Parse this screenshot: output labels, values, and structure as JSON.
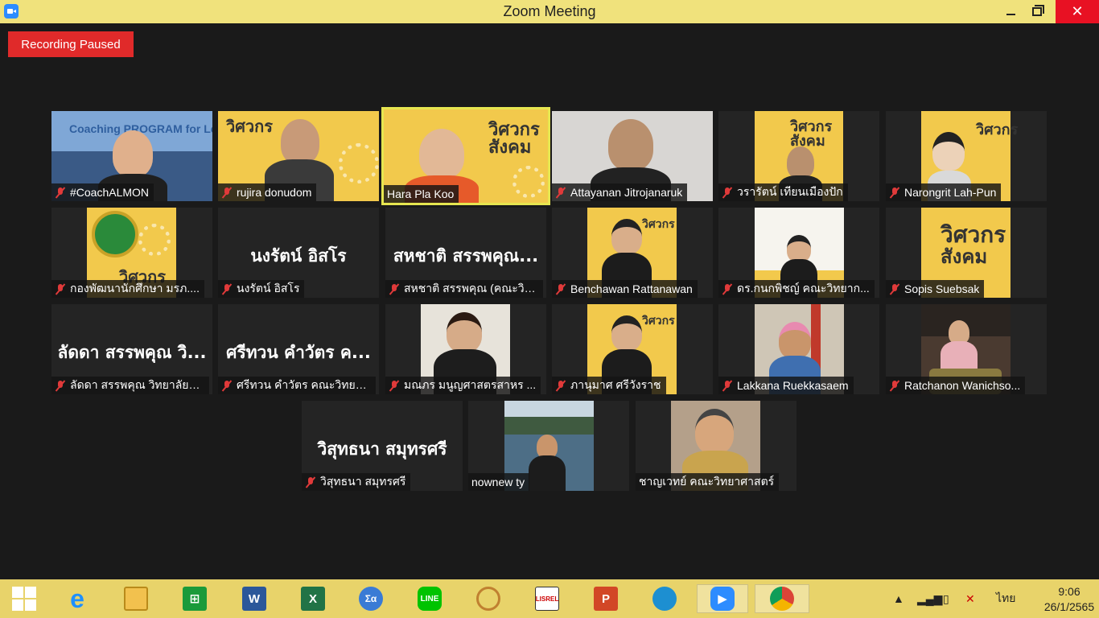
{
  "window": {
    "title": "Zoom Meeting"
  },
  "recording": {
    "label": "Recording Paused"
  },
  "participants": [
    {
      "name": "#CoachALMON",
      "overlay": "Coaching PROGRAM for Leader",
      "muted": true
    },
    {
      "name": "rujira donudom",
      "muted": true
    },
    {
      "name": "Hara Pla Koo",
      "muted": false
    },
    {
      "name": "Attayanan Jitrojanaruk",
      "muted": true
    },
    {
      "name": "วรารัตน์ เทียนเมืองปัก",
      "muted": true
    },
    {
      "name": "Narongrit Lah-Pun",
      "muted": true
    },
    {
      "name": "กองพัฒนานักศึกษา มรภ....",
      "muted": true
    },
    {
      "name": "นงรัตน์ อิสโร",
      "big": "นงรัตน์ อิสโร",
      "muted": true
    },
    {
      "name": "สหชาติ สรรพคุณ (คณะวิท...",
      "big": "สหชาติ สรรพคุณ...",
      "muted": true
    },
    {
      "name": "Benchawan Rattanawan",
      "muted": true
    },
    {
      "name": "ดร.กนกพิชญ์ คณะวิทยาก...",
      "muted": true
    },
    {
      "name": "Sopis Suebsak",
      "muted": true
    },
    {
      "name": "ลัดดา สรรพคุณ วิทยาลัยก...",
      "big": "ลัดดา สรรพคุณ วิ...",
      "muted": true
    },
    {
      "name": "ศรีทวน  คำวัตร คณะวิทยา...",
      "big": "ศรีทวน  คำวัตร ค...",
      "muted": true
    },
    {
      "name": "มณภร มนูญศาสตรสาหร ...",
      "muted": true
    },
    {
      "name": "ภานุมาศ ศรีวังราช",
      "muted": true
    },
    {
      "name": "Lakkana Ruekkasaem",
      "muted": true
    },
    {
      "name": "Ratchanon Wanichso...",
      "muted": true
    },
    {
      "name": "วิสุทธนา สมุทรศรี",
      "big": "วิสุทธนา สมุทรศรี",
      "muted": true
    },
    {
      "name": "nownew ty",
      "muted": false
    },
    {
      "name": "ชาญเวทย์  คณะวิทยาศาสตร์",
      "muted": false
    }
  ],
  "banner_text": {
    "line1": "วิศวกร",
    "line2": "สังคม"
  },
  "taskbar": {
    "icons": [
      "windows-start-icon",
      "internet-explorer-icon",
      "file-explorer-icon",
      "store-icon",
      "word-icon",
      "excel-icon",
      "math-input-icon",
      "line-icon",
      "paint-icon",
      "lisrel-icon",
      "powerpoint-icon",
      "edge-icon",
      "zoom-icon",
      "chrome-icon"
    ],
    "labels": {
      "word": "W",
      "excel": "X",
      "powerpoint": "P",
      "line": "LINE",
      "lisrel": "LISREL",
      "math": "Σα"
    },
    "lang": "ไทย",
    "time": "9:06",
    "date": "26/1/2565"
  }
}
